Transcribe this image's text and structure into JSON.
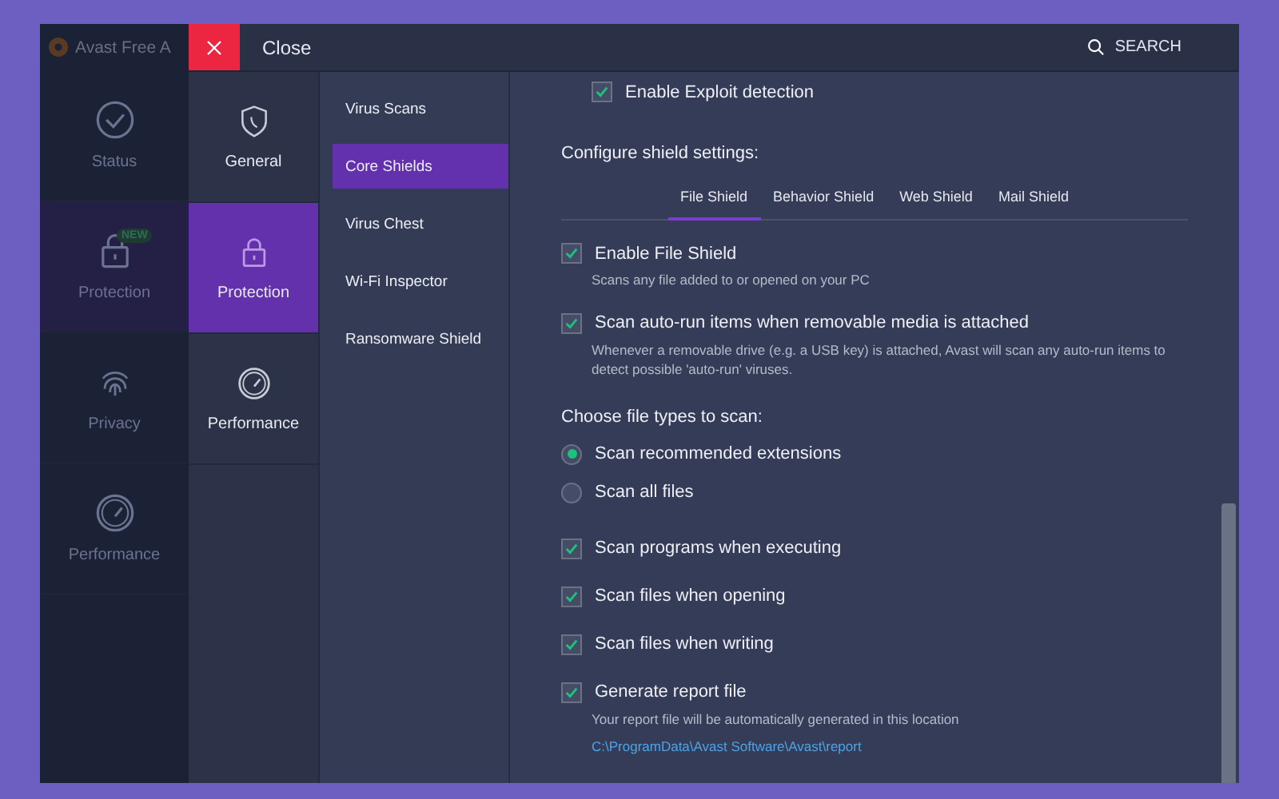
{
  "app": {
    "title": "Avast Free A",
    "nav": [
      {
        "label": "Status",
        "selected": false
      },
      {
        "label": "Protection",
        "selected": true,
        "badge": "NEW"
      },
      {
        "label": "Privacy",
        "selected": false
      },
      {
        "label": "Performance",
        "selected": false
      }
    ]
  },
  "header": {
    "close": "Close",
    "search": "SEARCH"
  },
  "categories": [
    {
      "label": "General",
      "selected": false
    },
    {
      "label": "Protection",
      "selected": true
    },
    {
      "label": "Performance",
      "selected": false
    }
  ],
  "subnav": [
    {
      "label": "Virus Scans",
      "selected": false
    },
    {
      "label": "Core Shields",
      "selected": true
    },
    {
      "label": "Virus Chest",
      "selected": false
    },
    {
      "label": "Wi-Fi Inspector",
      "selected": false
    },
    {
      "label": "Ransomware Shield",
      "selected": false
    }
  ],
  "content": {
    "exploit": {
      "label": "Enable Exploit detection",
      "checked": true
    },
    "section_title": "Configure shield settings:",
    "tabs": [
      {
        "label": "File Shield",
        "selected": true
      },
      {
        "label": "Behavior Shield",
        "selected": false
      },
      {
        "label": "Web Shield",
        "selected": false
      },
      {
        "label": "Mail Shield",
        "selected": false
      }
    ],
    "options": [
      {
        "label": "Enable File Shield",
        "checked": true,
        "description": "Scans any file added to or opened on your PC"
      },
      {
        "label": "Scan auto-run items when removable media is attached",
        "checked": true,
        "description": "Whenever a removable drive (e.g. a USB key) is attached, Avast will scan any auto-run items to detect possible 'auto-run' viruses."
      }
    ],
    "file_types_title": "Choose file types to scan:",
    "file_types": [
      {
        "label": "Scan recommended extensions",
        "selected": true
      },
      {
        "label": "Scan all files",
        "selected": false
      }
    ],
    "scan_options": [
      {
        "label": "Scan programs when executing",
        "checked": true
      },
      {
        "label": "Scan files when opening",
        "checked": true
      },
      {
        "label": "Scan files when writing",
        "checked": true
      },
      {
        "label": "Generate report file",
        "checked": true,
        "description": "Your report file will be automatically generated in this location",
        "link": "C:\\ProgramData\\Avast Software\\Avast\\report"
      }
    ]
  }
}
